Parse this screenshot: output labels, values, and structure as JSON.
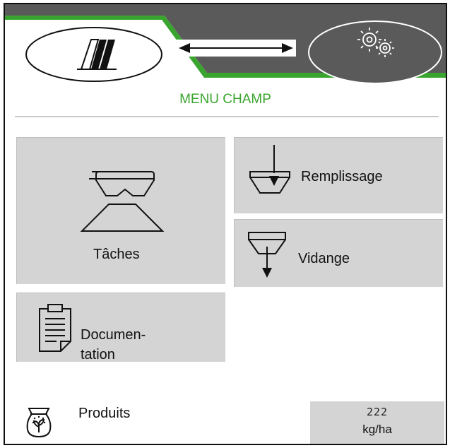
{
  "header": {
    "left_tab_icon": "field-pattern-icon",
    "switch_icon": "double-arrow-icon",
    "right_tab_icon": "gears-icon",
    "accent_color": "#3aa52e",
    "bar_color": "#5a5a5a"
  },
  "menu": {
    "title": "MENU CHAMP"
  },
  "tiles": {
    "taches": {
      "label": "Tâches",
      "icon": "spreader-icon"
    },
    "remplissage": {
      "label": "Remplissage",
      "icon": "hopper-fill-icon"
    },
    "vidange": {
      "label": "Vidange",
      "icon": "hopper-empty-icon"
    },
    "documentation": {
      "label_line1": "Documen-",
      "label_line2": "tation",
      "icon": "clipboard-icon"
    }
  },
  "footer": {
    "products_label": "Produits",
    "products_icon": "seed-bag-icon",
    "rate_value": "222",
    "rate_unit": "kg/ha"
  }
}
